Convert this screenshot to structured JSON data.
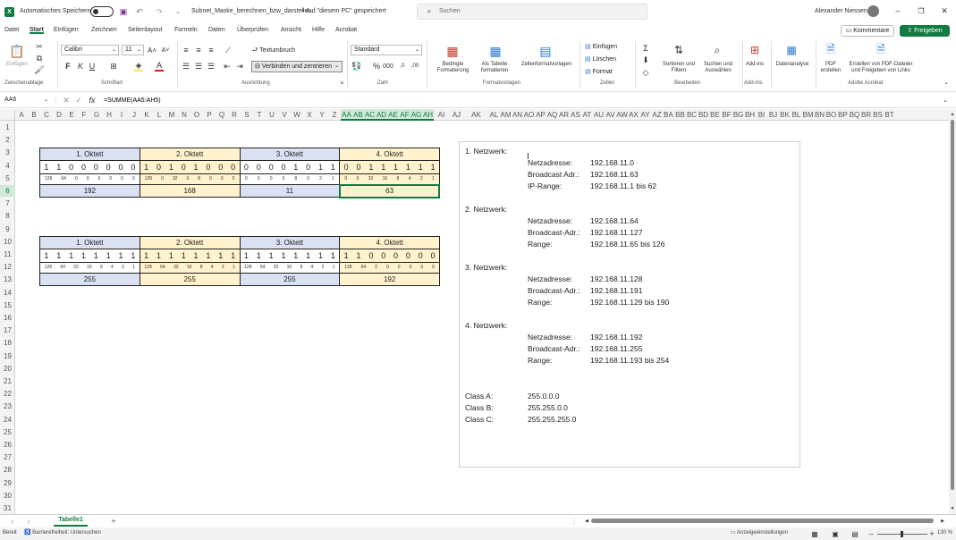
{
  "titlebar": {
    "autosave_label": "Automatisches Speichern",
    "doc_title": "Subnet_Maske_berechnen_bzw_darstellen...",
    "save_location": "• Auf \"diesem PC\" gespeichert",
    "search_placeholder": "Suchen",
    "user_name": "Alexander Niessen"
  },
  "menu": {
    "items": [
      "Datei",
      "Start",
      "Einfügen",
      "Zeichnen",
      "Seitenlayout",
      "Formeln",
      "Daten",
      "Überprüfen",
      "Ansicht",
      "Hilfe",
      "Acrobat"
    ],
    "active": "Start",
    "comments_label": "Kommentare",
    "share_label": "Freigeben"
  },
  "ribbon": {
    "paste_label": "Einfügen",
    "font_name": "Calibri",
    "font_size": "11",
    "wrap_label": "Textumbruch",
    "merge_label": "Verbinden und zentrieren",
    "number_format": "Standard",
    "cond_format_label": "Bedingte Formatierung",
    "as_table_label": "Als Tabelle formatieren",
    "cell_styles_label": "Zellenformatvorlagen",
    "insert_label": "Einfügen",
    "delete_label": "Löschen",
    "format_label": "Format",
    "sort_label": "Sortieren und Filtern",
    "find_label": "Suchen und Auswählen",
    "addins_label": "Add-ins",
    "data_analysis_label": "Datenanalyse",
    "pdf_create_label": "PDF erstellen",
    "pdf_share_label": "Erstellen von PDF-Dateien und Freigeben von Links",
    "groups": [
      "Zwischenablage",
      "Schriftart",
      "Ausrichtung",
      "Zahl",
      "Formatvorlagen",
      "Zellen",
      "Bearbeiten",
      "Add-Ins",
      "Adobe Acrobat"
    ]
  },
  "formula_bar": {
    "name_box": "AA6",
    "formula": "=SUMME(AA5:AH5)"
  },
  "columns": [
    "A",
    "B",
    "C",
    "D",
    "E",
    "F",
    "G",
    "H",
    "I",
    "J",
    "K",
    "L",
    "M",
    "N",
    "O",
    "P",
    "Q",
    "R",
    "S",
    "T",
    "U",
    "V",
    "W",
    "X",
    "Y",
    "Z",
    "AA",
    "AB",
    "AC",
    "AD",
    "AE",
    "AF",
    "AG",
    "AH",
    "AI",
    "AJ",
    "AK",
    "AL",
    "AM",
    "AN",
    "AO",
    "AP",
    "AQ",
    "AR",
    "AS",
    "AT",
    "AU",
    "AV",
    "AW",
    "AX",
    "AY",
    "AZ",
    "BA",
    "BB",
    "BC",
    "BD",
    "BE",
    "BF",
    "BG",
    "BH",
    "BI",
    "BJ",
    "BK",
    "BL",
    "BM",
    "BN",
    "BO",
    "BP",
    "BQ",
    "BR",
    "BS",
    "BT"
  ],
  "rows": [
    "1",
    "2",
    "3",
    "4",
    "5",
    "6",
    "7",
    "8",
    "9",
    "10",
    "11",
    "12",
    "13",
    "14",
    "15",
    "16",
    "17",
    "18",
    "19",
    "20",
    "21",
    "22",
    "23",
    "24",
    "25",
    "26",
    "27",
    "28",
    "29",
    "30",
    "31"
  ],
  "table1": {
    "headers": [
      "1. Oktett",
      "2. Oktett",
      "3. Oktett",
      "4. Oktett"
    ],
    "bits": [
      [
        "1",
        "1",
        "0",
        "0",
        "0",
        "0",
        "0",
        "0"
      ],
      [
        "1",
        "0",
        "1",
        "0",
        "1",
        "0",
        "0",
        "0"
      ],
      [
        "0",
        "0",
        "0",
        "0",
        "1",
        "0",
        "1",
        "1"
      ],
      [
        "0",
        "0",
        "1",
        "1",
        "1",
        "1",
        "1",
        "1"
      ]
    ],
    "weights": [
      [
        "128",
        "64",
        "0",
        "0",
        "0",
        "0",
        "0",
        "0"
      ],
      [
        "128",
        "0",
        "32",
        "0",
        "8",
        "0",
        "0",
        "0"
      ],
      [
        "0",
        "0",
        "0",
        "0",
        "8",
        "0",
        "2",
        "1"
      ],
      [
        "0",
        "0",
        "32",
        "16",
        "8",
        "4",
        "2",
        "1"
      ]
    ],
    "sums": [
      "192",
      "168",
      "11",
      "63"
    ]
  },
  "table2": {
    "headers": [
      "1. Oktett",
      "2. Oktett",
      "3. Oktett",
      "4. Oktett"
    ],
    "bits": [
      [
        "1",
        "1",
        "1",
        "1",
        "1",
        "1",
        "1",
        "1"
      ],
      [
        "1",
        "1",
        "1",
        "1",
        "1",
        "1",
        "1",
        "1"
      ],
      [
        "1",
        "1",
        "1",
        "1",
        "1",
        "1",
        "1",
        "1"
      ],
      [
        "1",
        "1",
        "0",
        "0",
        "0",
        "0",
        "0",
        "0"
      ]
    ],
    "weights": [
      [
        "128",
        "64",
        "32",
        "16",
        "8",
        "4",
        "2",
        "1"
      ],
      [
        "128",
        "64",
        "32",
        "16",
        "8",
        "4",
        "2",
        "1"
      ],
      [
        "128",
        "64",
        "32",
        "16",
        "8",
        "4",
        "2",
        "1"
      ],
      [
        "128",
        "64",
        "0",
        "0",
        "0",
        "0",
        "0",
        "0"
      ]
    ],
    "sums": [
      "255",
      "255",
      "255",
      "192"
    ]
  },
  "textbox": {
    "networks": [
      {
        "title": "1. Netzwerk:",
        "lines": [
          [
            "Netzadresse:",
            "192.168.11.0"
          ],
          [
            "Broadcast Adr.:",
            "192.168.11.63"
          ],
          [
            "IP-Range:",
            "192.168.11.1 bis 62"
          ]
        ]
      },
      {
        "title": "2. Netzwerk:",
        "lines": [
          [
            "Netzadresse:",
            "192.168.11.64"
          ],
          [
            "Broadcast-Adr.:",
            "192.168.11.127"
          ],
          [
            "Range:",
            "192.168.11.65 bis 126"
          ]
        ]
      },
      {
        "title": "3. Netzwerk:",
        "lines": [
          [
            "Netzadresse:",
            "192.168.11.128"
          ],
          [
            "Broadcast-Adr.:",
            "192.168.11.191"
          ],
          [
            "Range:",
            "192.168.11.129 bis 190"
          ]
        ]
      },
      {
        "title": "4. Netzwerk:",
        "lines": [
          [
            "Netzadresse:",
            "192.168.11.192"
          ],
          [
            "Broadcast-Adr.:",
            "192.168.11.255"
          ],
          [
            "Range:",
            "192.168.11.193 bis 254"
          ]
        ]
      }
    ],
    "classes": [
      [
        "Class A:",
        "255.0.0.0"
      ],
      [
        "Class B:",
        "255.255.0.0"
      ],
      [
        "Class C:",
        "255.255.255.0"
      ]
    ]
  },
  "sheets": {
    "tabs": [
      "Tabelle1"
    ],
    "active": "Tabelle1"
  },
  "status": {
    "ready": "Bereit",
    "accessibility": "Barrierefreiheit: Untersuchen",
    "display_settings": "Anzeigeeinstellungen",
    "zoom": "130 %"
  },
  "colors": {
    "green": "#107c41",
    "blue_fill": "#d9e1f2",
    "yellow_fill": "#fff2cc"
  }
}
